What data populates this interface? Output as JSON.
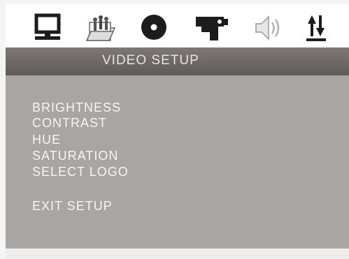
{
  "toolbar": {
    "icons": [
      {
        "name": "monitor-icon"
      },
      {
        "name": "language-folder-icon"
      },
      {
        "name": "disc-icon"
      },
      {
        "name": "camera-icon"
      },
      {
        "name": "speaker-icon"
      },
      {
        "name": "sort-arrows-icon"
      }
    ]
  },
  "title": "VIDEO SETUP",
  "menu": {
    "items": [
      "BRIGHTNESS",
      "CONTRAST",
      "HUE",
      "SATURATION",
      "SELECT LOGO"
    ],
    "exit": "EXIT SETUP"
  },
  "colors": {
    "title_bar": "#6e6a67",
    "panel": "#a8a5a2",
    "text": "#f6f6f6",
    "icon_dark": "#1c1c1c"
  }
}
